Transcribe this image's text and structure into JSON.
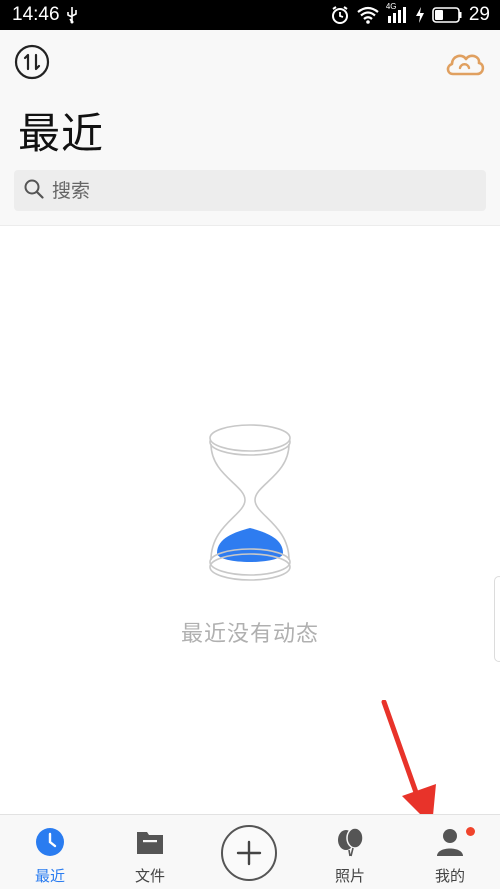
{
  "status_bar": {
    "time": "14:46",
    "battery_percent": "29",
    "network_label": "4G"
  },
  "header": {
    "title": "最近",
    "search_placeholder": "搜索"
  },
  "empty_state": {
    "message": "最近没有动态"
  },
  "bottom_nav": {
    "items": [
      {
        "label": "最近",
        "icon": "clock-icon",
        "active": true
      },
      {
        "label": "文件",
        "icon": "folder-icon",
        "active": false
      },
      {
        "label": "",
        "icon": "plus-icon",
        "active": false
      },
      {
        "label": "照片",
        "icon": "balloons-icon",
        "active": false
      },
      {
        "label": "我的",
        "icon": "person-icon",
        "active": false
      }
    ]
  },
  "colors": {
    "accent": "#2a7cf0",
    "cloud": "#e0a060",
    "badge": "#f0442c",
    "arrow": "#e8332a"
  }
}
